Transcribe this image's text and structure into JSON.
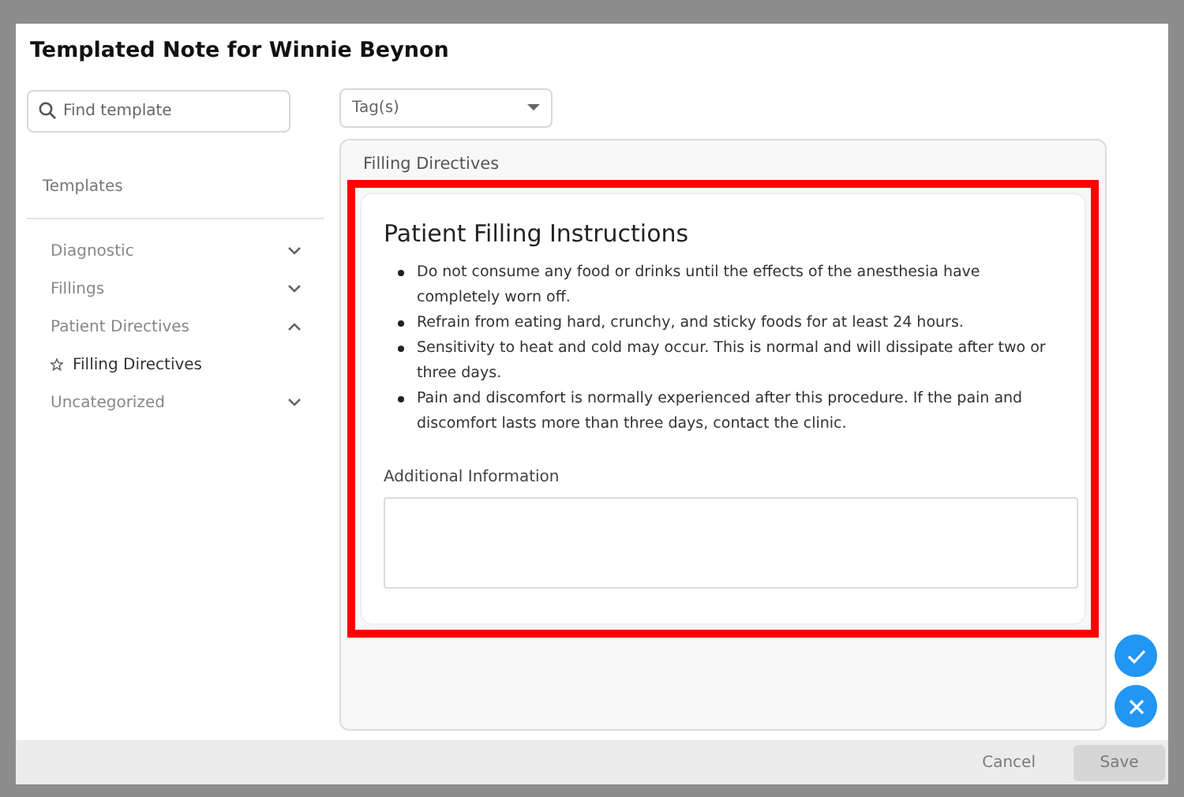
{
  "dialog": {
    "title": "Templated Note for Winnie Beynon"
  },
  "search": {
    "placeholder": "Find template"
  },
  "tags": {
    "placeholder": "Tag(s)"
  },
  "sidebar": {
    "heading": "Templates",
    "items": [
      {
        "label": "Diagnostic",
        "expanded": false
      },
      {
        "label": "Fillings",
        "expanded": false
      },
      {
        "label": "Patient Directives",
        "expanded": true,
        "children": [
          {
            "label": "Filling Directives",
            "starred": false
          }
        ]
      },
      {
        "label": "Uncategorized",
        "expanded": false
      }
    ]
  },
  "panel": {
    "title": "Filling Directives",
    "highlighted": true,
    "card": {
      "title": "Patient Filling Instructions",
      "bullets": [
        "Do not consume any food or drinks until the effects of the anesthesia have completely worn off.",
        "Refrain from eating hard, crunchy, and sticky foods for at least 24 hours.",
        "Sensitivity to heat and cold may occur. This is normal and will dissipate after two or three days.",
        "Pain and discomfort is normally experienced after this procedure. If the pain and discomfort lasts more than three days, contact the clinic."
      ],
      "field_label": "Additional Information"
    }
  },
  "footer": {
    "buttons": [
      {
        "kind": "text",
        "label": "Cancel",
        "disabled": true
      },
      {
        "kind": "filled",
        "label": "Save",
        "disabled": true
      }
    ]
  }
}
